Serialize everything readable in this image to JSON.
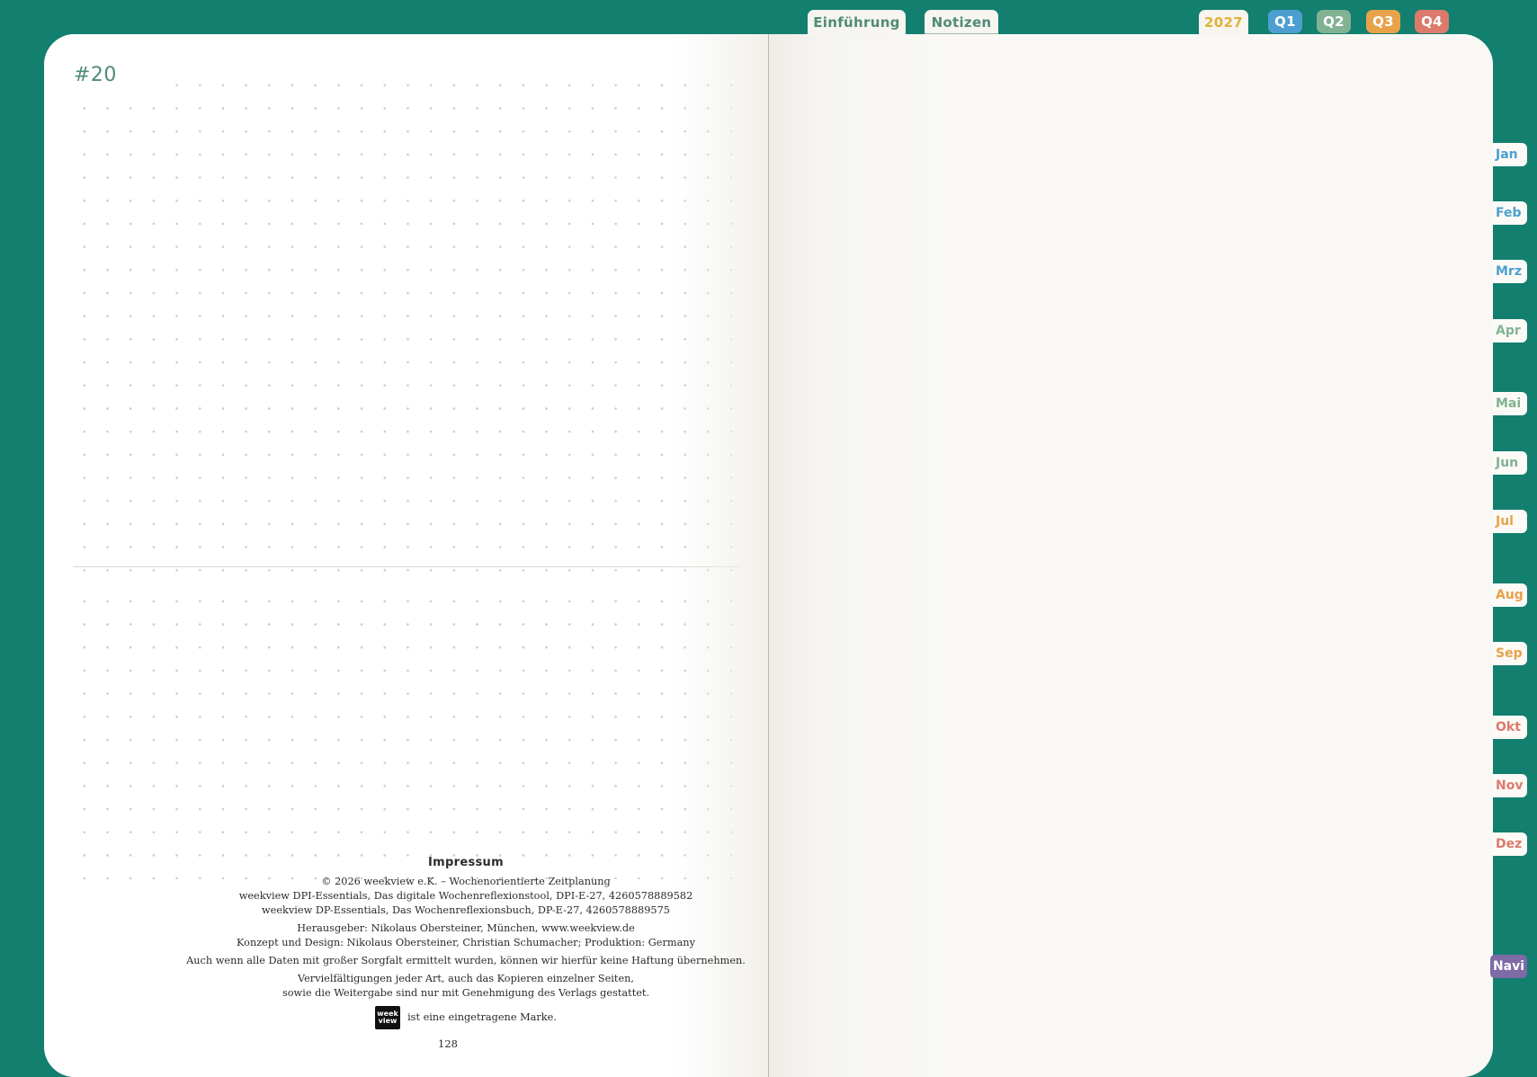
{
  "top_tabs": {
    "einfuehrung": "Einführung",
    "notizen": "Notizen",
    "year": "2027",
    "q1": "Q1",
    "q2": "Q2",
    "q3": "Q3",
    "q4": "Q4"
  },
  "colors": {
    "background": "#137f6f",
    "accent_text": "#4f8a79",
    "year": "#e0b23a",
    "q1": "#4d9fd1",
    "q2": "#82b294",
    "q3": "#e8a24a",
    "q4": "#dc7a6c",
    "navi": "#7e6aa6"
  },
  "left_page": {
    "title": "#20"
  },
  "impressum": {
    "heading": "Impressum",
    "line1": "© 2026  weekview e.K. – Wochenorientierte Zeitplanung",
    "line2": "weekview DPI-Essentials, Das digitale Wochenreflexionstool, DPI-E-27, 4260578889582",
    "line3": "weekview DP-Essentials, Das Wochenreflexionsbuch, DP-E-27, 4260578889575",
    "line4": "Herausgeber: Nikolaus Obersteiner, München, www.weekview.de",
    "line5": "Konzept und Design: Nikolaus Obersteiner, Christian Schumacher; Produktion: Germany",
    "line6": "Auch wenn alle Daten mit großer Sorgfalt ermittelt wurden,  können wir hierfür keine Haftung übernehmen.",
    "line7": "Vervielfältigungen jeder Art, auch das Kopieren einzelner Seiten,",
    "line8": "sowie die Weitergabe sind nur mit Genehmigung des Verlags gestattet.",
    "logo_top": "week",
    "logo_bottom": "view",
    "trademark": "ist eine eingetragene Marke.",
    "page_number": "128"
  },
  "months": [
    {
      "label": "Jan",
      "color": "#4d9fd1"
    },
    {
      "label": "Feb",
      "color": "#4d9fd1"
    },
    {
      "label": "Mrz",
      "color": "#4d9fd1"
    },
    {
      "label": "Apr",
      "color": "#82b294"
    },
    {
      "label": "Mai",
      "color": "#82b294"
    },
    {
      "label": "Jun",
      "color": "#82b294"
    },
    {
      "label": "Jul",
      "color": "#e8a24a"
    },
    {
      "label": "Aug",
      "color": "#e8a24a"
    },
    {
      "label": "Sep",
      "color": "#e8a24a"
    },
    {
      "label": "Okt",
      "color": "#dc7a6c"
    },
    {
      "label": "Nov",
      "color": "#dc7a6c"
    },
    {
      "label": "Dez",
      "color": "#dc7a6c"
    }
  ],
  "navi": "Navi"
}
